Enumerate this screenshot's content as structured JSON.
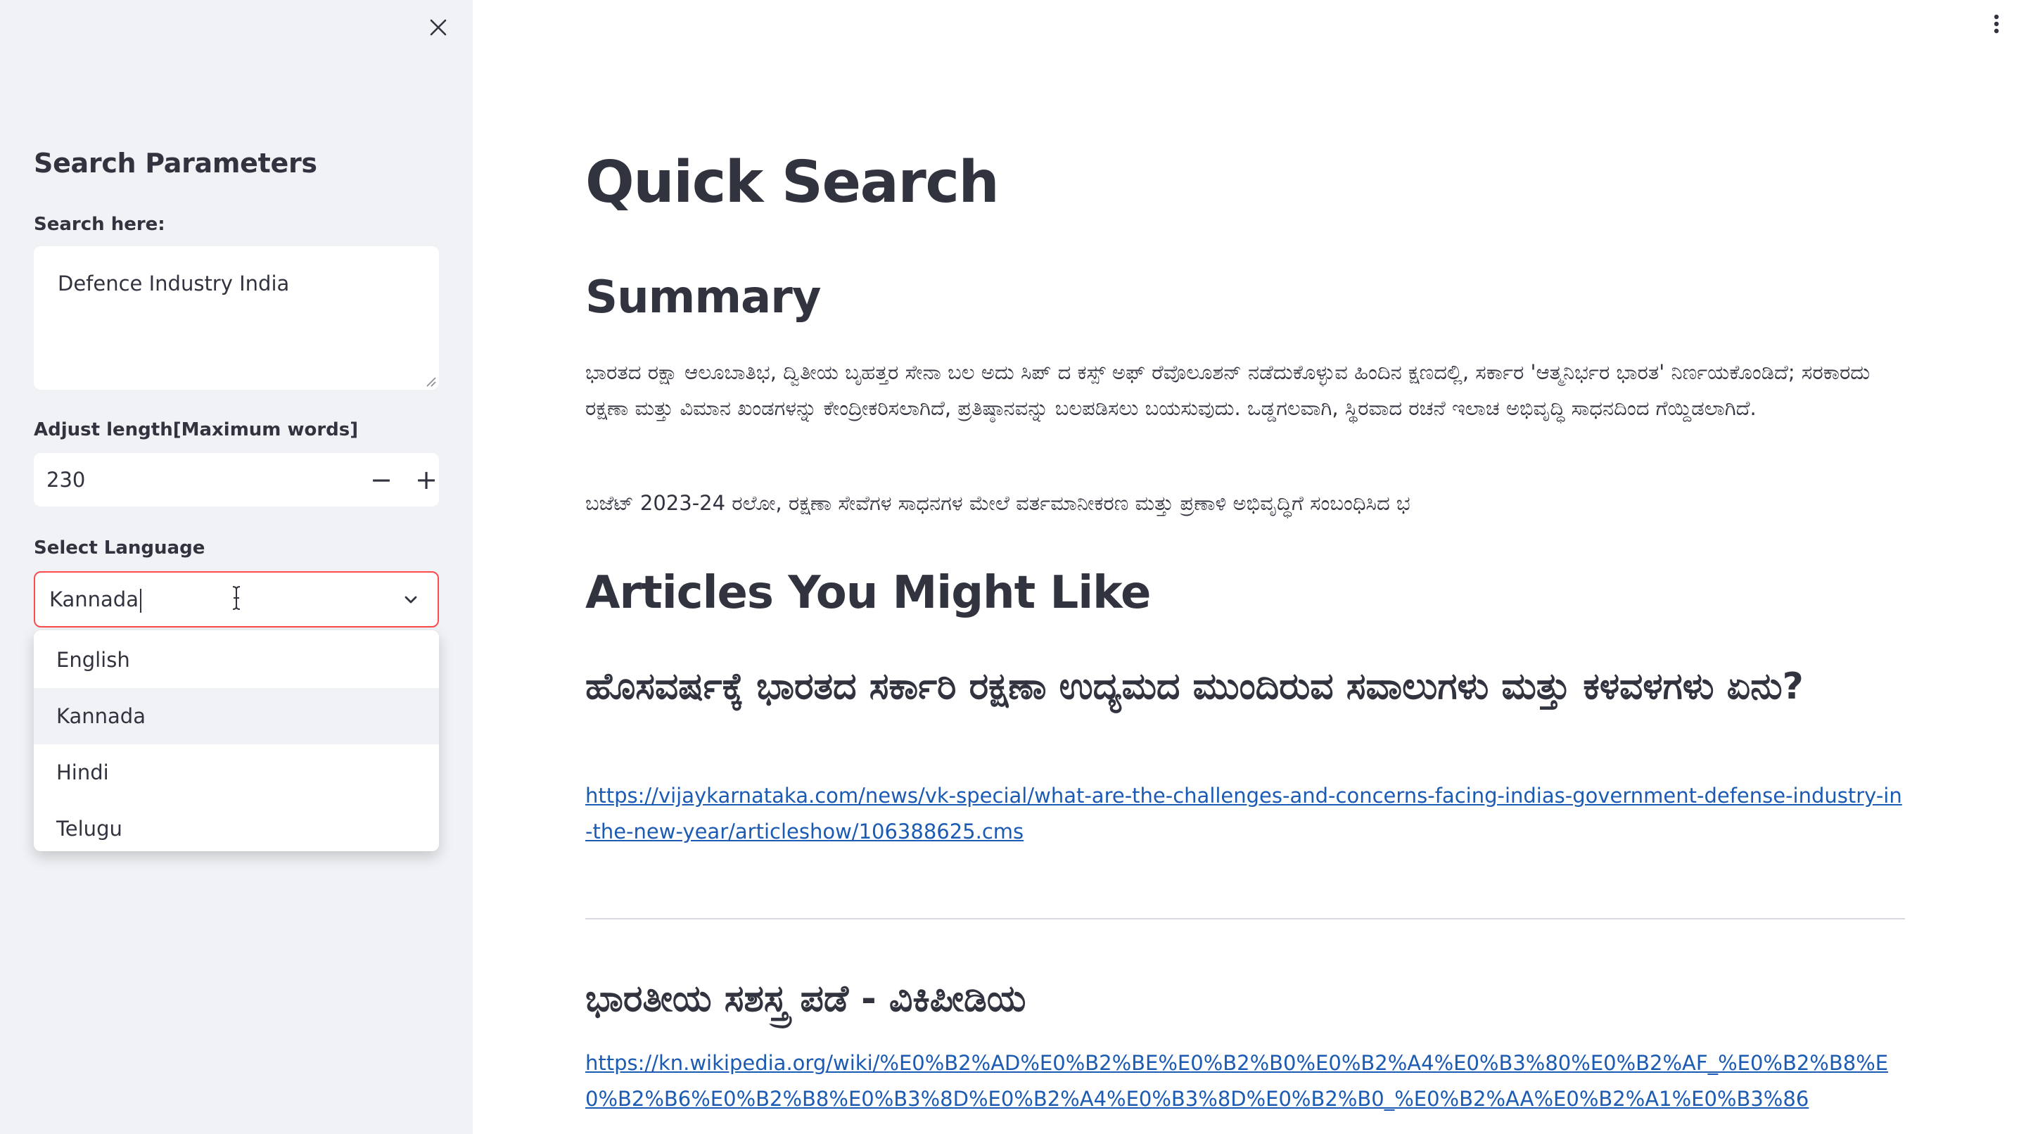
{
  "sidebar": {
    "title": "Search Parameters",
    "search_label": "Search here:",
    "search_value": "Defence Industry India",
    "length_label": "Adjust length[Maximum words]",
    "length_value": "230",
    "decrement_label": "−",
    "increment_label": "+",
    "language_label": "Select Language",
    "language_value": "Kannada",
    "language_options": [
      "English",
      "Kannada",
      "Hindi",
      "Telugu"
    ]
  },
  "main": {
    "title": "Quick Search",
    "summary_heading": "Summary",
    "summary_paragraphs": [
      "ಭಾರತದ ರಕ್ಷಾ ಆಲೂಬಾತಿಭ, ದ್ವಿತೀಯ ಬೃಹತ್ತರ ಸೇನಾ ಬಲ ಅದು ಸಿಪ್ ದ ಕಸ್ಪ್ ಅಫ್ ರೆವೊಲೂಶನ್ ನಡೆದುಕೊಳ್ಳುವ ಹಿಂದಿನ ಕ್ಷಣದಲ್ಲಿ, ಸರ್ಕಾರ 'ಆತ್ಮನಿರ್ಭರ ಭಾರತ' ನಿರ್ಣಯಕೊಂಡಿದೆ; ಸರಕಾರದು ರಕ್ಷಣಾ ಮತ್ತು ವಿಮಾನ ಖಂಡಗಳನ್ನು ಕೇಂದ್ರೀಕರಿಸಲಾಗಿದೆ, ಪ್ರತಿಷ್ಠಾನವನ್ನು ಬಲಪಡಿಸಲು ಬಯಸುವುದು. ಒಡ್ಡಗಲವಾಗಿ, ಸ್ಥಿರವಾದ ರಚನೆ ಇಲಾಚ ಅಭಿವೃದ್ಧಿ ಸಾಧನದಿಂದ ಗೆಯ್ದಿಡಲಾಗಿದೆ.",
      "ಬಜೆಟ್ 2023-24 ರಲೋ, ರಕ್ಷಣಾ ಸೇವೆಗಳ ಸಾಧನಗಳ ಮೇಲೆ ವರ್ತಮಾನೀಕರಣ ಮತ್ತು ಪ್ರಣಾಳಿ ಅಭಿವೃದ್ಧಿಗೆ ಸಂಬಂಧಿಸಿದ ಭ"
    ],
    "articles_heading": "Articles You Might Like",
    "articles": [
      {
        "title": "ಹೊಸವರ್ಷಕ್ಕೆ ಭಾರತದ ಸರ್ಕಾರಿ ರಕ್ಷಣಾ ಉದ್ಯಮದ ಮುಂದಿರುವ ಸವಾಲುಗಳು ಮತ್ತು ಕಳವಳಗಳು ಏನು?",
        "url": "https://vijaykarnataka.com/news/vk-special/what-are-the-challenges-and-concerns-facing-indias-government-defense-industry-in-the-new-year/articleshow/106388625.cms"
      },
      {
        "title": "ಭಾರತೀಯ ಸಶಸ್ತ್ರ ಪಡೆ - ವಿಕಿಪೀಡಿಯ",
        "url": "https://kn.wikipedia.org/wiki/%E0%B2%AD%E0%B2%BE%E0%B2%B0%E0%B2%A4%E0%B3%80%E0%B2%AF_%E0%B2%B8%E0%B2%B6%E0%B2%B8%E0%B3%8D%E0%B2%A4%E0%B3%8D%E0%B2%B0_%E0%B2%AA%E0%B2%A1%E0%B3%86"
      }
    ]
  },
  "colors": {
    "sidebar_bg": "#f0f2f6",
    "text": "#31333f",
    "accent_border": "#ff4b4b",
    "link": "#1c5bb3"
  },
  "icons": {
    "close": "close-icon",
    "menu": "kebab-menu-icon",
    "dropdown": "chevron-down-icon",
    "cursor": "text-cursor-icon",
    "resize": "resize-grip-icon"
  }
}
